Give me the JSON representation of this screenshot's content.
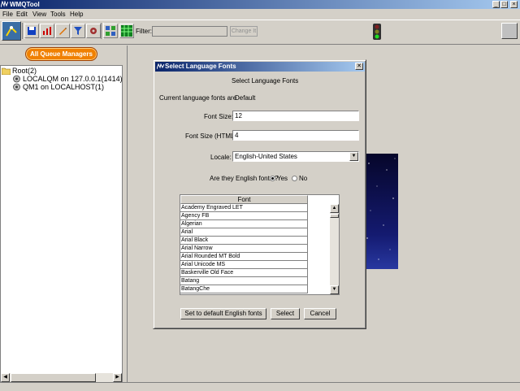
{
  "window": {
    "title": "WMQTool",
    "minimize": "_",
    "maximize": "□",
    "close": "×"
  },
  "menu": [
    "File",
    "Edit",
    "View",
    "Tools",
    "Help"
  ],
  "toolbar": {
    "filter_label": "Filter:",
    "filter_value": "",
    "change_button": "Change It"
  },
  "left_panel": {
    "queue_managers_button": "All Queue Managers",
    "tree": {
      "root": "Root(2)",
      "children": [
        "LOCALQM on 127.0.0.1(1414)",
        "QM1 on LOCALHOST(1)"
      ]
    }
  },
  "dialog": {
    "title": "Select Language Fonts",
    "heading": "Select Language Fonts",
    "current_label": "Current language fonts are",
    "current_value": "Default",
    "font_size_label": "Font Size:",
    "font_size_value": "12",
    "font_size_html_label": "Font Size (HTML):",
    "font_size_html_value": "4",
    "locale_label": "Locale:",
    "locale_value": "English-United States",
    "english_question": "Are they English fonts ?",
    "yes_label": "Yes",
    "no_label": "No",
    "english_selected": "Yes",
    "table_header": "Font",
    "fonts": [
      "Academy Engraved LET",
      "Agency FB",
      "Algerian",
      "Arial",
      "Arial Black",
      "Arial Narrow",
      "Arial Rounded MT Bold",
      "Arial Unicode MS",
      "Baskerville Old Face",
      "Batang",
      "BatangChe"
    ],
    "buttons": {
      "default": "Set to default English fonts",
      "select": "Select",
      "cancel": "Cancel"
    }
  }
}
